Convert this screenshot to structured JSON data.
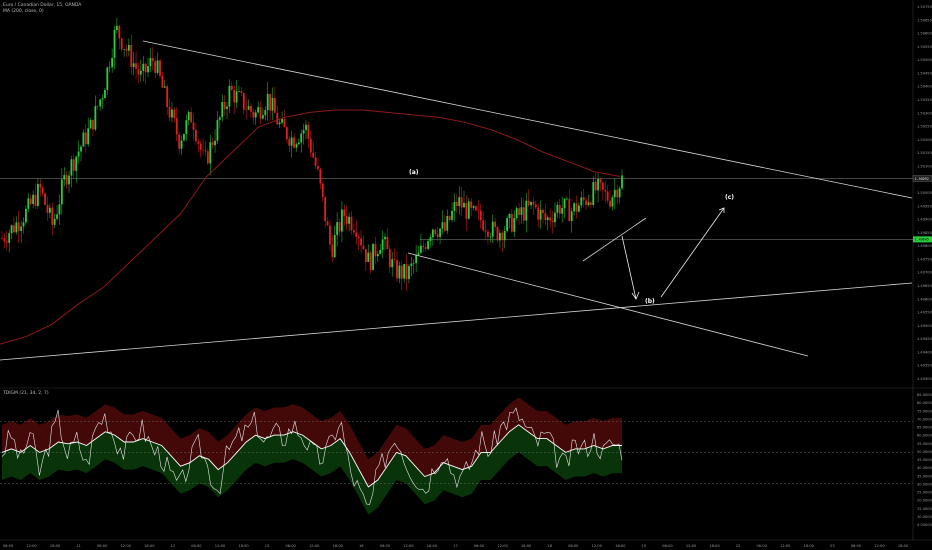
{
  "header": {
    "symbol_line": "Euro / Canadian Dollar, 15, OANDA",
    "ma_line": "MA (200, close, 0)"
  },
  "indicator": {
    "label": "TDIGM (21, 34, 2, 7)"
  },
  "colors": {
    "background": "#000000",
    "bull": "#2ecc40",
    "bear": "#e02020",
    "ma": "#8b1a1a",
    "trendline": "#d8d8d8",
    "rsi": "#e8e8e8",
    "band_upper_fill": "#4a0a0a",
    "band_lower_fill": "#0a3a0a"
  },
  "chart_data": [
    {
      "type": "candlestick",
      "title": "Euro / Canadian Dollar, 15, OANDA",
      "ylim": [
        1.4925,
        1.508
      ],
      "y_ticks": [
        "1.50750",
        "1.50650",
        "1.50600",
        "1.50550",
        "1.50500",
        "1.50450",
        "1.50400",
        "1.50350",
        "1.50300",
        "1.50250",
        "1.50200",
        "1.50150",
        "1.50100",
        "1.50050",
        "1.50000",
        "1.49950",
        "1.49900",
        "1.49850",
        "1.49800",
        "1.49750",
        "1.49700",
        "1.49650",
        "1.49600",
        "1.49550",
        "1.49500",
        "1.49450",
        "1.49400",
        "1.49350",
        "1.49300"
      ],
      "current_price": "1.50092",
      "support_price": "1.49845",
      "x_ticks": [
        "06:00",
        "12:00",
        "18:00",
        "11",
        "06:00",
        "12:00",
        "18:00",
        "12",
        "06:00",
        "12:00",
        "18:00",
        "15",
        "06:00",
        "12:00",
        "18:00",
        "16",
        "06:00",
        "12:00",
        "18:00",
        "17",
        "06:00",
        "12:00",
        "18:00",
        "18",
        "06:00",
        "12:00",
        "18:00",
        "19",
        "06:00",
        "12:00",
        "18:00",
        "22",
        "06:00",
        "12:00",
        "18:00",
        "23",
        "06:00",
        "12:00",
        "18:00"
      ],
      "close_path": [
        1.4985,
        1.499,
        1.4996,
        1.5005,
        1.499,
        1.501,
        1.502,
        1.503,
        1.5045,
        1.507,
        1.506,
        1.505,
        1.5058,
        1.504,
        1.5025,
        1.5035,
        1.5015,
        1.503,
        1.5045,
        1.504,
        1.5035,
        1.5042,
        1.503,
        1.5025,
        1.503,
        1.501,
        1.498,
        1.4995,
        1.499,
        1.4975,
        1.4985,
        1.4972,
        1.497,
        1.4978,
        1.499,
        1.4988,
        1.5,
        1.4995,
        1.4992,
        1.4987,
        1.499,
        1.4995,
        1.4998,
        1.4992,
        1.4998,
        1.4996,
        1.5,
        1.5005,
        1.5001,
        1.5009
      ],
      "ma200": [
        1.4942,
        1.4945,
        1.495,
        1.4958,
        1.4965,
        1.4975,
        1.4985,
        1.4995,
        1.501,
        1.502,
        1.503,
        1.5034,
        1.5036,
        1.5037,
        1.5037,
        1.5036,
        1.5035,
        1.5034,
        1.5032,
        1.5029,
        1.5025,
        1.502,
        1.5016,
        1.5012,
        1.501
      ],
      "annotations": [
        "(a)",
        "(b)",
        "(c)"
      ]
    },
    {
      "type": "line",
      "title": "TDIGM (21, 34, 2, 7)",
      "ylim": [
        5,
        85
      ],
      "y_ticks": [
        "85.00000",
        "80.00000",
        "75.00000",
        "70.00000",
        "65.00000",
        "60.00000",
        "55.00000",
        "50.00000",
        "45.00000",
        "40.00000",
        "35.00000",
        "30.00000",
        "25.00000",
        "20.00000",
        "15.00000",
        "10.00000",
        "5.00000"
      ],
      "levels": [
        68,
        50,
        32
      ],
      "rsi": [
        50,
        60,
        45,
        62,
        38,
        55,
        70,
        48,
        58,
        42,
        65,
        72,
        58,
        50,
        60,
        64,
        52,
        48,
        36,
        30,
        45,
        55,
        40,
        28,
        50,
        58,
        62,
        68,
        55,
        62,
        58,
        66,
        60,
        50,
        46,
        55,
        70,
        40,
        28,
        15,
        38,
        50,
        60,
        45,
        36,
        28,
        42,
        52,
        38,
        35,
        45,
        58,
        50,
        64,
        70,
        72,
        62,
        56,
        60,
        48,
        42,
        54,
        52,
        58,
        50,
        56,
        52
      ],
      "signal": [
        50,
        52,
        50,
        54,
        50,
        52,
        56,
        55,
        56,
        54,
        58,
        62,
        60,
        56,
        56,
        58,
        56,
        54,
        48,
        42,
        44,
        48,
        46,
        40,
        44,
        50,
        56,
        60,
        58,
        60,
        60,
        62,
        60,
        56,
        52,
        54,
        58,
        50,
        40,
        30,
        34,
        42,
        50,
        48,
        42,
        36,
        38,
        44,
        42,
        40,
        42,
        50,
        50,
        56,
        62,
        66,
        62,
        58,
        58,
        54,
        50,
        52,
        52,
        54,
        52,
        54,
        54
      ]
    }
  ]
}
